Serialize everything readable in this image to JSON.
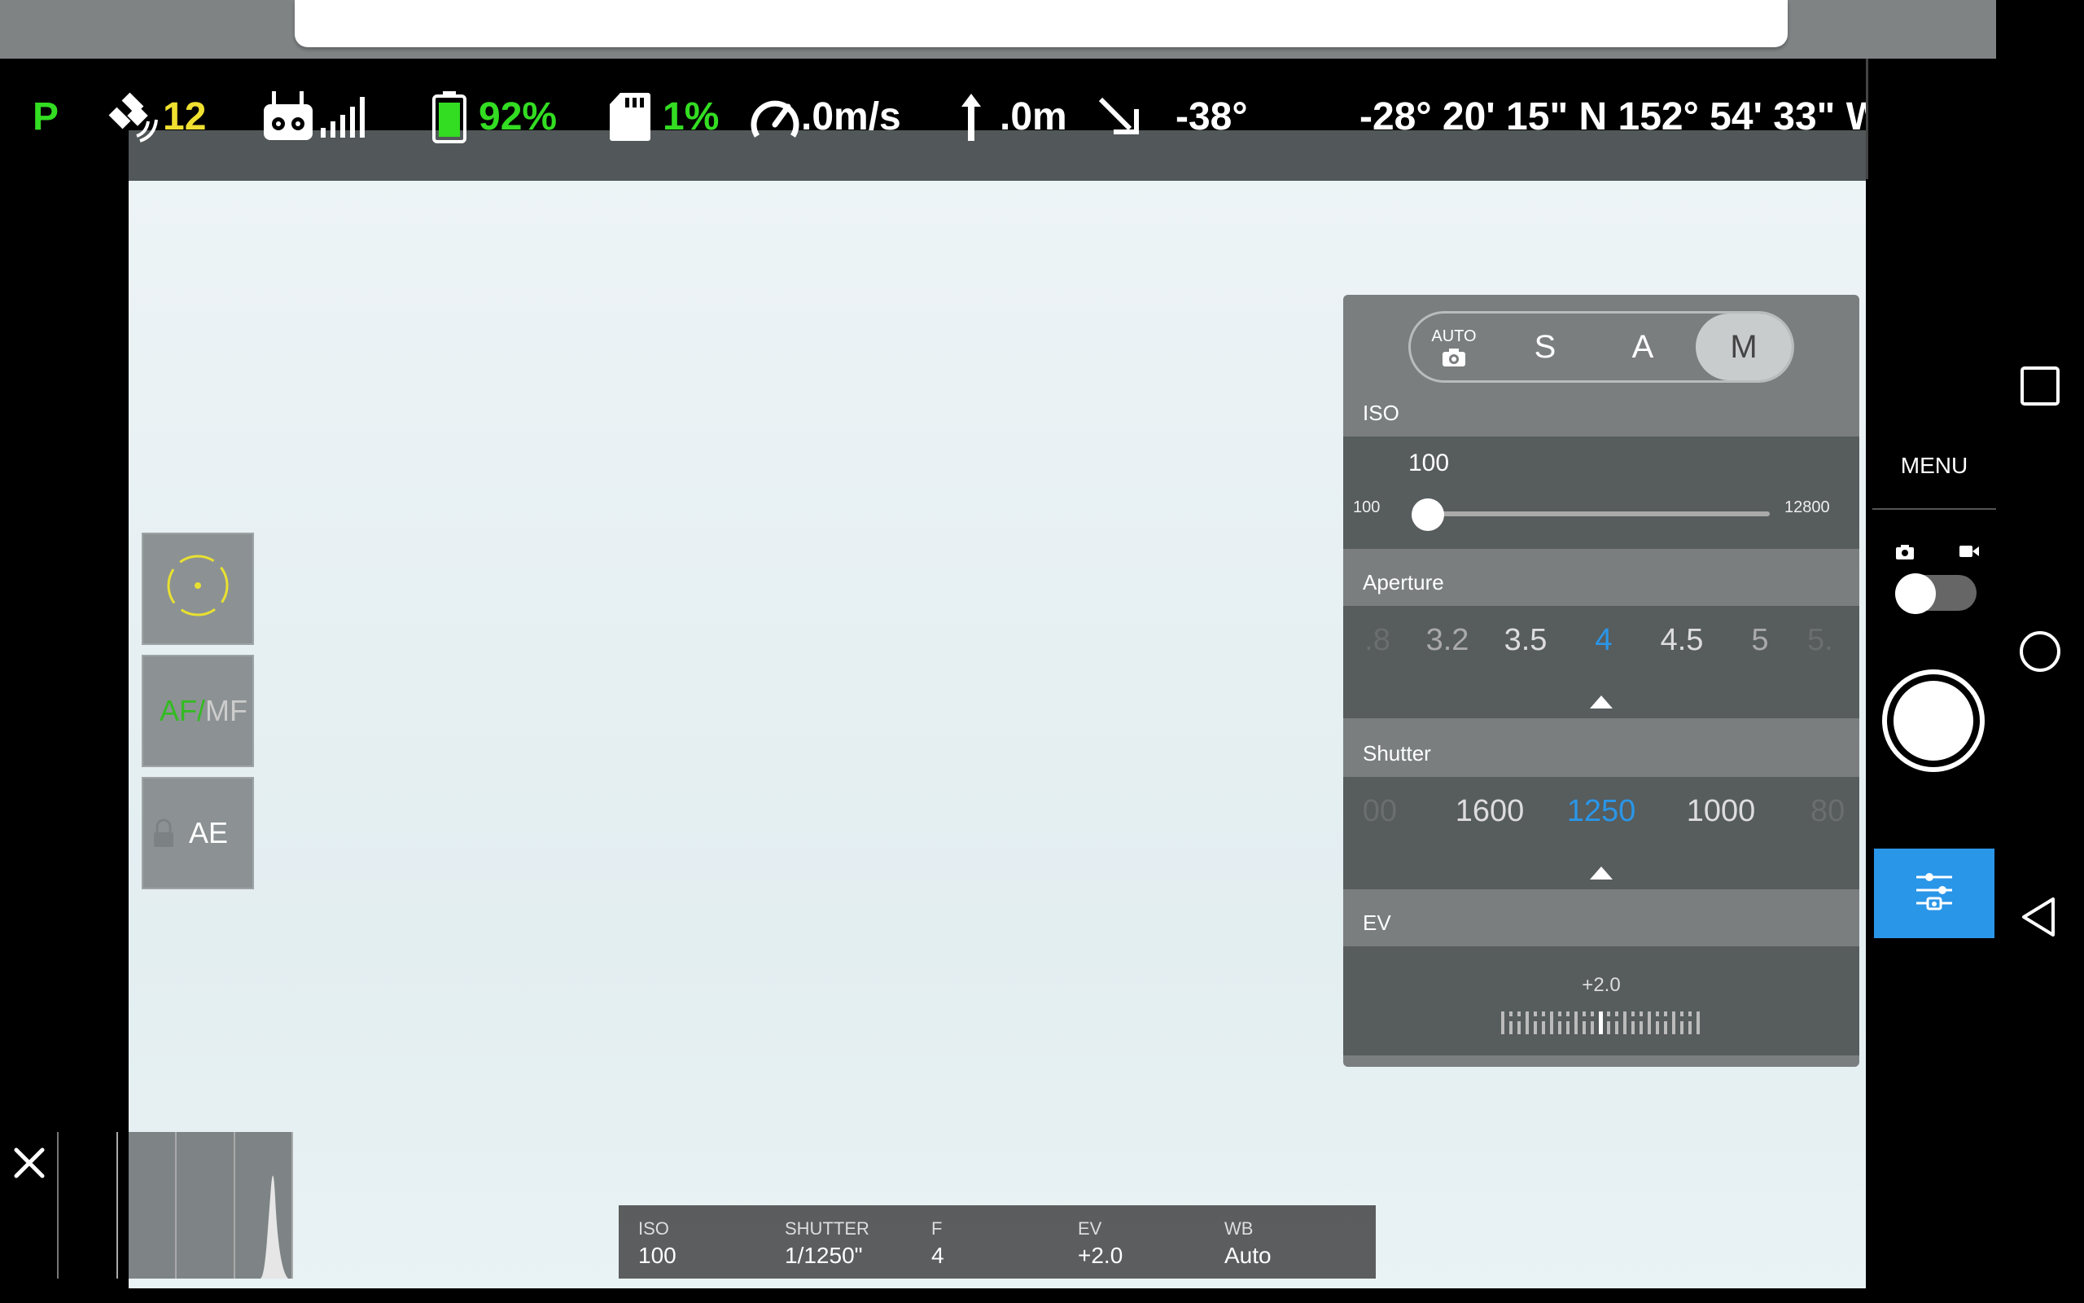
{
  "telemetry": {
    "flight_mode": "P",
    "satellites": "12",
    "battery": "92%",
    "sd_card": "1%",
    "speed": ".0m/s",
    "altitude": ".0m",
    "gimbal_pitch": "-38°",
    "coordinates": "-28° 20' 15\" N 152° 54' 33\" W"
  },
  "right_panel": {
    "menu_label": "MENU"
  },
  "tools": {
    "af_label": "AF/",
    "mf_label": "MF",
    "ae_label": "AE"
  },
  "camera_panel": {
    "modes": [
      "AUTO",
      "S",
      "A",
      "M"
    ],
    "selected_mode": "M",
    "iso": {
      "label": "ISO",
      "value": "100",
      "min": "100",
      "max": "12800",
      "fraction": 0.0
    },
    "aperture": {
      "label": "Aperture",
      "values": [
        ".8",
        "3.2",
        "3.5",
        "4",
        "4.5",
        "5",
        "5."
      ],
      "selected": "4"
    },
    "shutter": {
      "label": "Shutter",
      "values": [
        "00",
        "1600",
        "1250",
        "1000",
        "80"
      ],
      "selected": "1250"
    },
    "ev": {
      "label": "EV",
      "value": "+2.0"
    }
  },
  "bottom_info": {
    "iso_label": "ISO",
    "iso_value": "100",
    "shutter_label": "SHUTTER",
    "shutter_value": "1/1250\"",
    "f_label": "F",
    "f_value": "4",
    "ev_label": "EV",
    "ev_value": "+2.0",
    "wb_label": "WB",
    "wb_value": "Auto"
  },
  "colors": {
    "accent_blue": "#2a96e8",
    "status_green": "#33dd22",
    "status_yellow": "#f0e030"
  }
}
